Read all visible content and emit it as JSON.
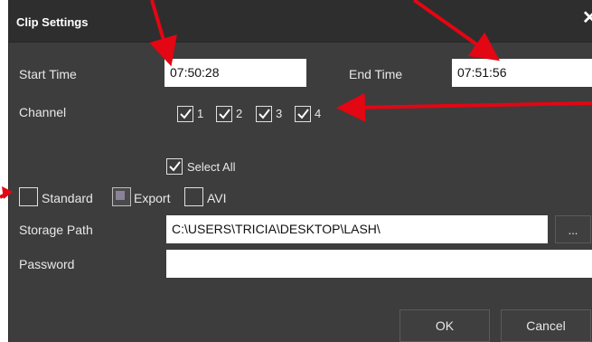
{
  "dialog": {
    "title": "Clip Settings",
    "close_glyph": "✕"
  },
  "form": {
    "start_time_label": "Start Time",
    "start_time_value": "07:50:28",
    "end_time_label": "End Time",
    "end_time_value": "07:51:56",
    "channel_label": "Channel",
    "channels": [
      {
        "label": "1",
        "checked": true
      },
      {
        "label": "2",
        "checked": true
      },
      {
        "label": "3",
        "checked": true
      },
      {
        "label": "4",
        "checked": true
      }
    ],
    "select_all_label": "Select All",
    "formats": [
      {
        "label": "Standard",
        "selected": false
      },
      {
        "label": "Export",
        "selected": true
      },
      {
        "label": "AVI",
        "selected": false
      }
    ],
    "storage_path_label": "Storage Path",
    "storage_path_value": "C:\\USERS\\TRICIA\\DESKTOP\\LASH\\",
    "browse_label": "...",
    "password_label": "Password",
    "password_value": ""
  },
  "buttons": {
    "ok_label": "OK",
    "cancel_label": "Cancel"
  },
  "colors": {
    "dialog_bg": "#3d3d3d",
    "titlebar_bg": "#2e2e2e",
    "annotation_arrow": "#e30613"
  }
}
